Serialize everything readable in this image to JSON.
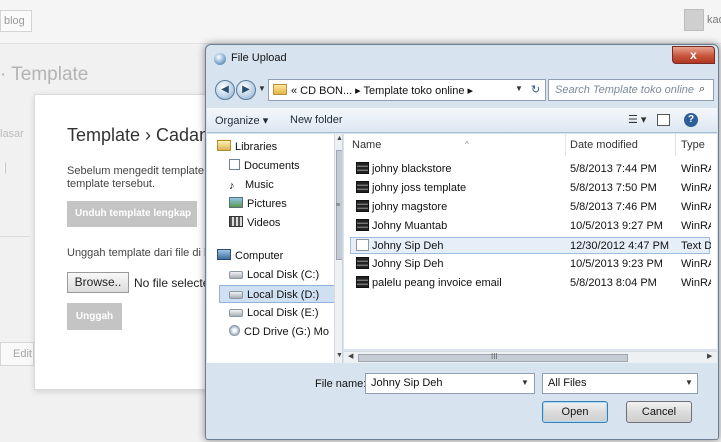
{
  "background_page": {
    "blog_chip": "blog",
    "user_name": "kad",
    "page_title": "· Template",
    "side_text": "lasar",
    "side_mark": "|",
    "edit_button": "Edit",
    "panel": {
      "title": "Template › Cadang",
      "description": "Sebelum mengedit template A template tersebut.",
      "download_button": "Unduh template lengkap",
      "upload_label": "Unggah template dari file di ha",
      "browse_button": "Browse..",
      "no_file_text": "No file selected",
      "upload_button": "Unggah"
    }
  },
  "dialog": {
    "title": "File Upload",
    "close_symbol": "x",
    "back_symbol": "◀",
    "forward_symbol": "▶",
    "dropdown_symbol": "▼",
    "refresh_symbol": "↻",
    "address_path": "« CD BON... ▸ Template toko online ▸",
    "search_placeholder": "Search Template toko online",
    "search_symbol": "⌕",
    "toolbar": {
      "organize": "Organize ▾",
      "new_folder": "New folder",
      "view_symbol": "☰ ▾",
      "help_symbol": "?"
    },
    "nav_items": [
      {
        "label": "Libraries",
        "icon": "libraries-icon"
      },
      {
        "label": "Documents",
        "icon": "documents-icon"
      },
      {
        "label": "Music",
        "icon": "music-icon",
        "glyph": "♪"
      },
      {
        "label": "Pictures",
        "icon": "pictures-icon"
      },
      {
        "label": "Videos",
        "icon": "videos-icon"
      },
      {
        "label": "Computer",
        "icon": "computer-icon"
      },
      {
        "label": "Local Disk (C:)",
        "icon": "hard-drive-icon"
      },
      {
        "label": "Local Disk (D:)",
        "icon": "hard-drive-icon",
        "selected": true
      },
      {
        "label": "Local Disk (E:)",
        "icon": "hard-drive-icon"
      },
      {
        "label": "CD Drive (G:) Mo",
        "icon": "cd-drive-icon"
      }
    ],
    "scroll_symbols": {
      "up": "▲",
      "down": "▼",
      "left": "◀",
      "right": "▶",
      "grip": "≡",
      "hgrip": "III"
    },
    "columns": {
      "name": "Name",
      "date": "Date modified",
      "type": "Type",
      "sort_symbol": "^"
    },
    "files": [
      {
        "name": "johny blackstore",
        "date": "5/8/2013 7:44 PM",
        "type": "WinRAR Z",
        "kind": "rar"
      },
      {
        "name": "johny joss template",
        "date": "5/8/2013 7:50 PM",
        "type": "WinRAR Z",
        "kind": "rar"
      },
      {
        "name": "johny magstore",
        "date": "5/8/2013 7:46 PM",
        "type": "WinRAR Z",
        "kind": "rar"
      },
      {
        "name": "Johny Muantab",
        "date": "10/5/2013 9:27 PM",
        "type": "WinRAR Z",
        "kind": "rar"
      },
      {
        "name": "Johny Sip Deh",
        "date": "12/30/2012 4:47 PM",
        "type": "Text Docu",
        "kind": "txt",
        "selected": true
      },
      {
        "name": "Johny Sip Deh",
        "date": "10/5/2013 9:23 PM",
        "type": "WinRAR Z",
        "kind": "rar"
      },
      {
        "name": "palelu peang invoice email",
        "date": "5/8/2013 8:04 PM",
        "type": "WinRAR Z",
        "kind": "rar"
      }
    ],
    "file_name_label": "File name:",
    "file_name_value": "Johny Sip Deh",
    "file_type_value": "All Files",
    "open_button": "Open",
    "cancel_button": "Cancel"
  }
}
